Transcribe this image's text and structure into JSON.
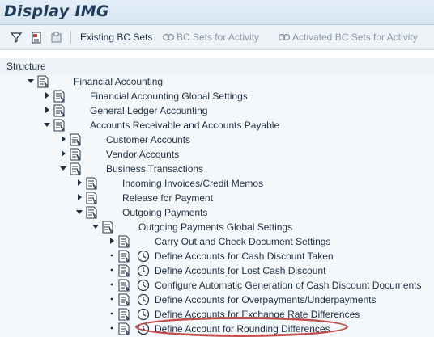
{
  "window": {
    "title": "Display IMG"
  },
  "toolbar": {
    "existing_bc_sets": "Existing BC Sets",
    "bc_sets_for_activity": "BC Sets for Activity",
    "activated_bc_sets_for_activity": "Activated BC Sets for Activity"
  },
  "structure": {
    "header": "Structure",
    "items": [
      {
        "label": "Financial Accounting"
      },
      {
        "label": "Financial Accounting Global Settings"
      },
      {
        "label": "General Ledger Accounting"
      },
      {
        "label": "Accounts Receivable and Accounts Payable"
      },
      {
        "label": "Customer Accounts"
      },
      {
        "label": "Vendor Accounts"
      },
      {
        "label": "Business Transactions"
      },
      {
        "label": "Incoming Invoices/Credit Memos"
      },
      {
        "label": "Release for Payment"
      },
      {
        "label": "Outgoing Payments"
      },
      {
        "label": "Outgoing Payments Global Settings"
      },
      {
        "label": "Carry Out and Check Document Settings"
      },
      {
        "label": "Define Accounts for Cash Discount Taken"
      },
      {
        "label": "Define Accounts for Lost Cash Discount"
      },
      {
        "label": "Configure Automatic Generation of Cash Discount Documents"
      },
      {
        "label": "Define Accounts for Overpayments/Underpayments"
      },
      {
        "label": "Define Accounts for Exchange Rate Differences"
      },
      {
        "label": "Define Account for Rounding Differences"
      }
    ]
  },
  "colors": {
    "highlight_circle": "#c0504d"
  }
}
